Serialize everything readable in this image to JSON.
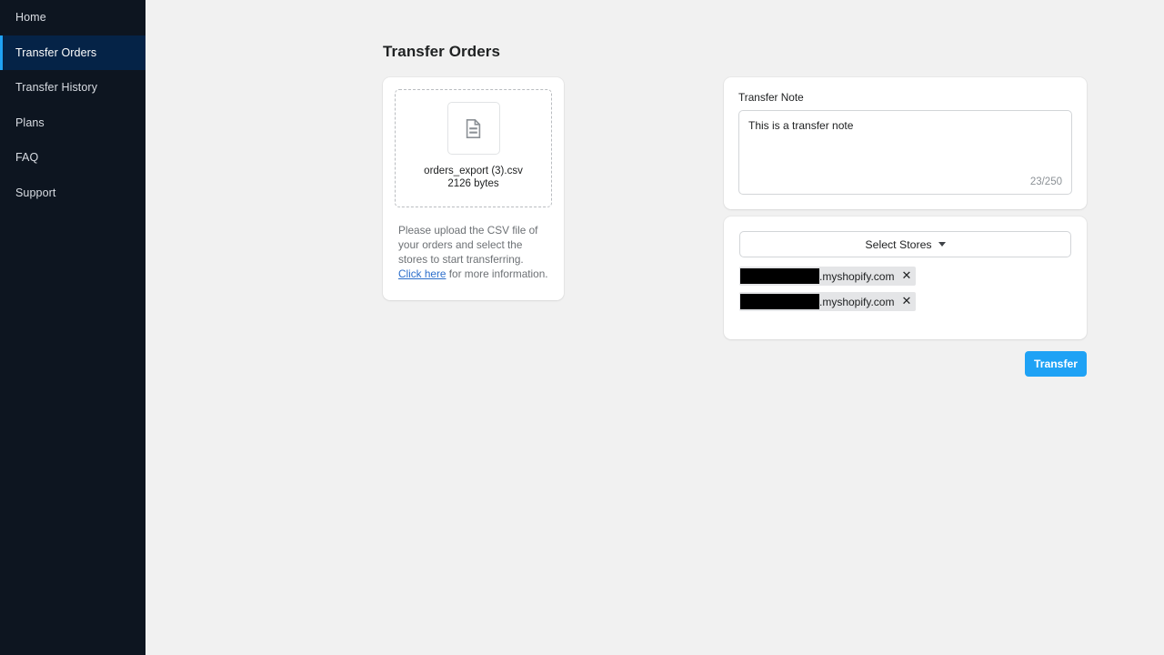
{
  "sidebar": {
    "items": [
      {
        "label": "Home",
        "active": false
      },
      {
        "label": "Transfer Orders",
        "active": true
      },
      {
        "label": "Transfer History",
        "active": false
      },
      {
        "label": "Plans",
        "active": false
      },
      {
        "label": "FAQ",
        "active": false
      },
      {
        "label": "Support",
        "active": false
      }
    ],
    "background_color": "#0d1520",
    "active_background_color": "#052347",
    "active_accent_color": "#1fa2f5"
  },
  "page": {
    "title": "Transfer Orders",
    "background_color": "#f1f1f1"
  },
  "upload_card": {
    "file_icon": "document-icon",
    "file_name": "orders_export (3).csv",
    "file_size": "2126 bytes",
    "help_text_before": "Please upload the CSV file of your orders and select the stores to start transferring. ",
    "help_link": "Click here",
    "help_text_after": " for more information.",
    "link_color": "#2c6ecb"
  },
  "note_card": {
    "label": "Transfer Note",
    "value": "This is a transfer note",
    "placeholder": "",
    "counter": "23/250",
    "max_length": 250,
    "current_length": 23
  },
  "stores_card": {
    "select_label": "Select Stores",
    "caret_icon": "chevron-down-icon",
    "chips": [
      {
        "redacted_width": 87,
        "domain": ".myshopify.com",
        "remove_icon": "close-icon"
      },
      {
        "redacted_width": 87,
        "domain": ".myshopify.com",
        "remove_icon": "close-icon"
      }
    ]
  },
  "actions": {
    "transfer_label": "Transfer",
    "transfer_color": "#1fa2f5"
  }
}
